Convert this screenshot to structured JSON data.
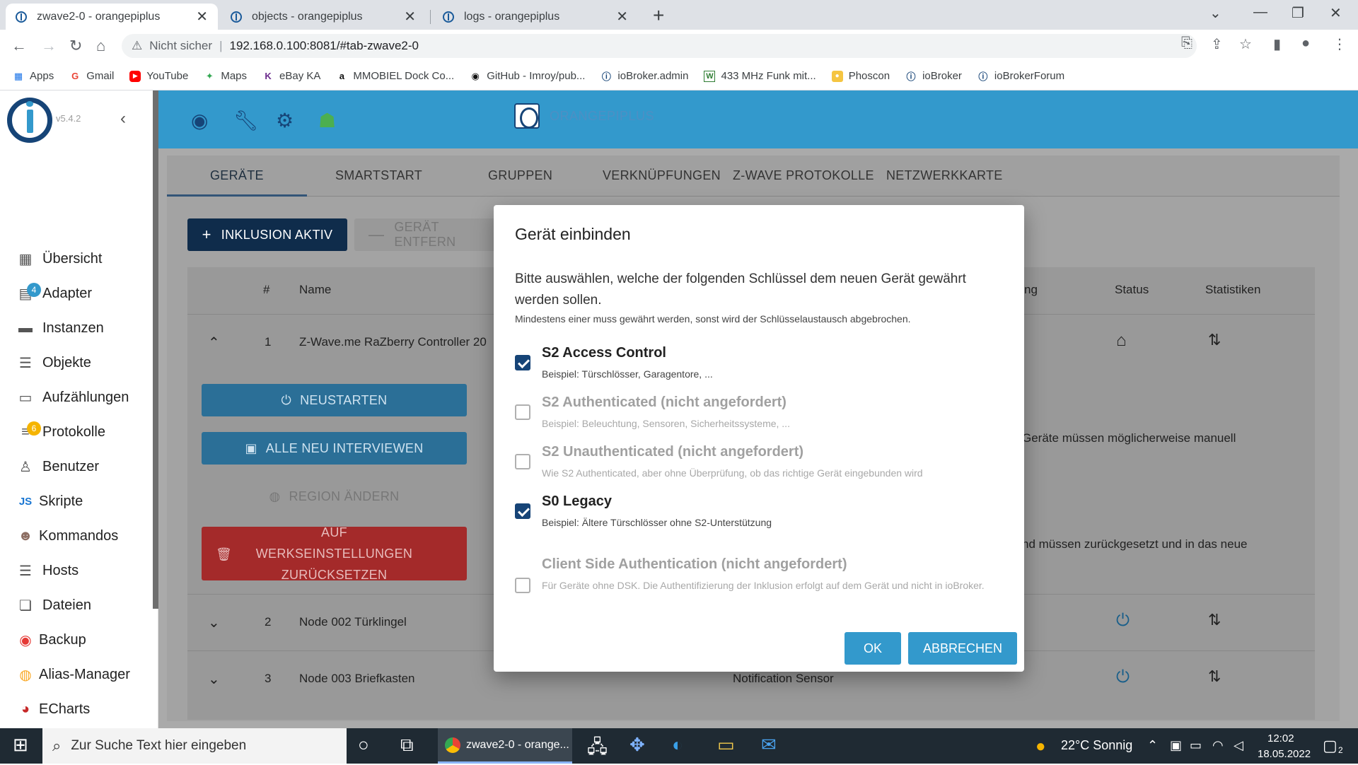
{
  "browser": {
    "tabs": [
      {
        "title": "zwave2-0 - orangepiplus",
        "active": true
      },
      {
        "title": "objects - orangepiplus",
        "active": false
      },
      {
        "title": "logs - orangepiplus",
        "active": false
      }
    ],
    "not_secure": "Nicht sicher",
    "url": "192.168.0.100:8081/#tab-zwave2-0",
    "bookmarks": [
      {
        "label": "Apps",
        "icon": "apps-grid-icon"
      },
      {
        "label": "Gmail",
        "icon": "google-g-icon"
      },
      {
        "label": "YouTube",
        "icon": "youtube-icon"
      },
      {
        "label": "Maps",
        "icon": "maps-pin-icon"
      },
      {
        "label": "eBay KA",
        "icon": "kleinanzeigen-icon"
      },
      {
        "label": "MMOBIEL Dock Co...",
        "icon": "amazon-icon"
      },
      {
        "label": "GitHub - Imroy/pub...",
        "icon": "github-icon"
      },
      {
        "label": "ioBroker.admin",
        "icon": "iobroker-icon"
      },
      {
        "label": "433 MHz Funk mit...",
        "icon": "w-icon"
      },
      {
        "label": "Phoscon",
        "icon": "phoscon-icon"
      },
      {
        "label": "ioBroker",
        "icon": "iobroker-icon"
      },
      {
        "label": "ioBrokerForum",
        "icon": "iobroker-icon"
      }
    ]
  },
  "sidebar": {
    "version": "v5.4.2",
    "items": [
      {
        "label": "Übersicht",
        "icon": "grid-icon"
      },
      {
        "label": "Adapter",
        "icon": "store-icon",
        "badge": "4"
      },
      {
        "label": "Instanzen",
        "icon": "instances-icon"
      },
      {
        "label": "Objekte",
        "icon": "list-icon"
      },
      {
        "label": "Aufzählungen",
        "icon": "enums-icon"
      },
      {
        "label": "Protokolle",
        "icon": "log-icon",
        "badge": "6"
      },
      {
        "label": "Benutzer",
        "icon": "user-icon"
      },
      {
        "label": "Skripte",
        "icon": "js-icon"
      },
      {
        "label": "Kommandos",
        "icon": "terminal-person-icon"
      },
      {
        "label": "Hosts",
        "icon": "hosts-icon"
      },
      {
        "label": "Dateien",
        "icon": "files-icon"
      },
      {
        "label": "Backup",
        "icon": "backup-icon"
      },
      {
        "label": "Alias-Manager",
        "icon": "alias-icon"
      },
      {
        "label": "ECharts",
        "icon": "echarts-icon"
      }
    ]
  },
  "topbar": {
    "title": "ORANGEPIPLUS"
  },
  "zwave": {
    "tabs": [
      "GERÄTE",
      "SMARTSTART",
      "GRUPPEN",
      "VERKNÜPFUNGEN",
      "Z-WAVE PROTOKOLLE",
      "NETZWERKKARTE"
    ],
    "inclusion_button": "INKLUSION AKTIV",
    "exclusion_button": "GERÄT ENTFERN",
    "table_headers": {
      "num": "#",
      "name": "Name",
      "type_partial": "ng",
      "status": "Status",
      "stats": "Statistiken"
    },
    "rows": [
      {
        "num": "1",
        "name": "Z-Wave.me RaZberry Controller 20",
        "type": ""
      },
      {
        "num": "2",
        "name": "Node 002 Türklingel",
        "type": ""
      },
      {
        "num": "3",
        "name": "Node 003 Briefkasten",
        "type": "Notification Sensor"
      }
    ],
    "controller_actions": {
      "restart": "NEUSTARTEN",
      "reinterview": "ALLE NEU INTERVIEWEN",
      "region": "REGION ÄNDERN",
      "factory_reset": "AUF WERKSEINSTELLUNGEN ZURÜCKSETZEN"
    },
    "side_text_1": "Geräte müssen möglicherweise manuell",
    "side_text_2": "nd müssen zurückgesetzt und in das neue"
  },
  "dialog": {
    "title": "Gerät einbinden",
    "description": "Bitte auswählen, welche der folgenden Schlüssel dem neuen Gerät gewährt werden sollen.",
    "note": "Mindestens einer muss gewährt werden, sonst wird der Schlüsselaustausch abgebrochen.",
    "options": [
      {
        "title": "S2 Access Control",
        "sub": "Beispiel: Türschlösser, Garagentore, ...",
        "checked": true,
        "enabled": true
      },
      {
        "title": "S2 Authenticated (nicht angefordert)",
        "sub": "Beispiel: Beleuchtung, Sensoren, Sicherheitssysteme, ...",
        "checked": false,
        "enabled": false
      },
      {
        "title": "S2 Unauthenticated (nicht angefordert)",
        "sub": "Wie S2 Authenticated, aber ohne Überprüfung, ob das richtige Gerät eingebunden wird",
        "checked": false,
        "enabled": false
      },
      {
        "title": "S0 Legacy",
        "sub": "Beispiel: Ältere Türschlösser ohne S2-Unterstützung",
        "checked": true,
        "enabled": true
      },
      {
        "title": "Client Side Authentication (nicht angefordert)",
        "sub": "Für Geräte ohne DSK. Die Authentifizierung der Inklusion erfolgt auf dem Gerät und nicht in ioBroker.",
        "checked": false,
        "enabled": false
      }
    ],
    "ok_label": "OK",
    "cancel_label": "ABBRECHEN"
  },
  "taskbar": {
    "search_placeholder": "Zur Suche Text hier eingeben",
    "chrome_item": "zwave2-0 - orange...",
    "weather": "22°C Sonnig",
    "time": "12:02",
    "date": "18.05.2022",
    "notifications": "2"
  },
  "colors": {
    "primary": "#3399cc",
    "dark": "#164477",
    "danger": "#d32f2f"
  }
}
